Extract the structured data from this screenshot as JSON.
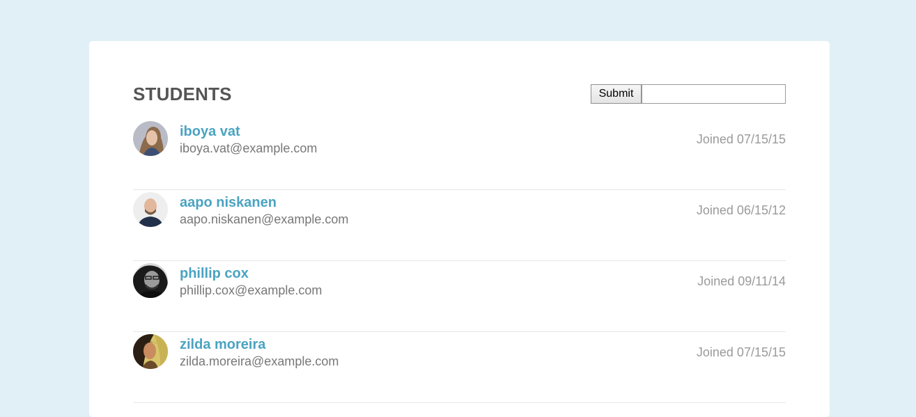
{
  "title": "STUDENTS",
  "search": {
    "button_label": "Submit",
    "input_value": ""
  },
  "colors": {
    "background": "#e1f0f6",
    "name_link": "#4aa3c2",
    "title": "#555555"
  },
  "students": [
    {
      "name": "iboya vat",
      "email": "iboya.vat@example.com",
      "joined": "Joined 07/15/15"
    },
    {
      "name": "aapo niskanen",
      "email": "aapo.niskanen@example.com",
      "joined": "Joined 06/15/12"
    },
    {
      "name": "phillip cox",
      "email": "phillip.cox@example.com",
      "joined": "Joined 09/11/14"
    },
    {
      "name": "zilda moreira",
      "email": "zilda.moreira@example.com",
      "joined": "Joined 07/15/15"
    }
  ]
}
